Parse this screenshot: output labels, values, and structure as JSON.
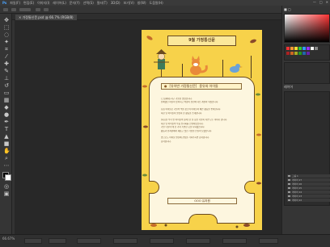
{
  "app": {
    "menu": [
      "파일(F)",
      "편집(E)",
      "이미지(I)",
      "레이어(L)",
      "문자(Y)",
      "선택(S)",
      "필터(T)",
      "3D(D)",
      "보기(V)",
      "창(W)",
      "도움말(H)"
    ],
    "tab_title": "× 가정통신문.psd @ 66.7% (RGB/8)"
  },
  "document": {
    "title": "9월 가정통신문",
    "subheading_school": "[유아반 가정통신문]",
    "subheading_label": "용유와 아이들",
    "body": [
      "(그림제재) 지구 가을을 맞았습니다.",
      "유쾌했던 하늘이 높아지고 바람이 선선해 다른 계절이 되었습니다.",
      "",
      "요즘 아이들은 가을의 색을 찾으며 아이들이 예쁜 활동을 좋아합니다.",
      "지난 달 아이들이 열심히 한 활동을 소개합니다.",
      "",
      "[다음달 우리 반 아이들의 정서] 한 달 동안 가을이 되면 모두 이야기 합니다.",
      "지난 달 아이들의 작품 전시회를 진행하였습니다.",
      "가을 나들이 때 한 가지 특별한 곳을 다녀왔습니다.",
      "활동과 유치원에서 새롭고 멋진 가을을 만들어 보겠습니다.",
      "",
      "앞으로도 아이들 발달에 관심을 가져주시면 감사합니다.",
      "감사합니다."
    ],
    "signature": "OOO 유치원"
  },
  "colors": {
    "doc_bg": "#f7d24a",
    "paper": "#fdf6df",
    "ink": "#5a3a1a"
  },
  "layers": [
    "그룹 1",
    "레이어 27",
    "레이어 26",
    "레이어 25",
    "레이어 24",
    "레이어 23",
    "레이어 22",
    "레이어 21",
    "레이어 20",
    "배경"
  ],
  "status": {
    "zoom": "66.67%"
  }
}
